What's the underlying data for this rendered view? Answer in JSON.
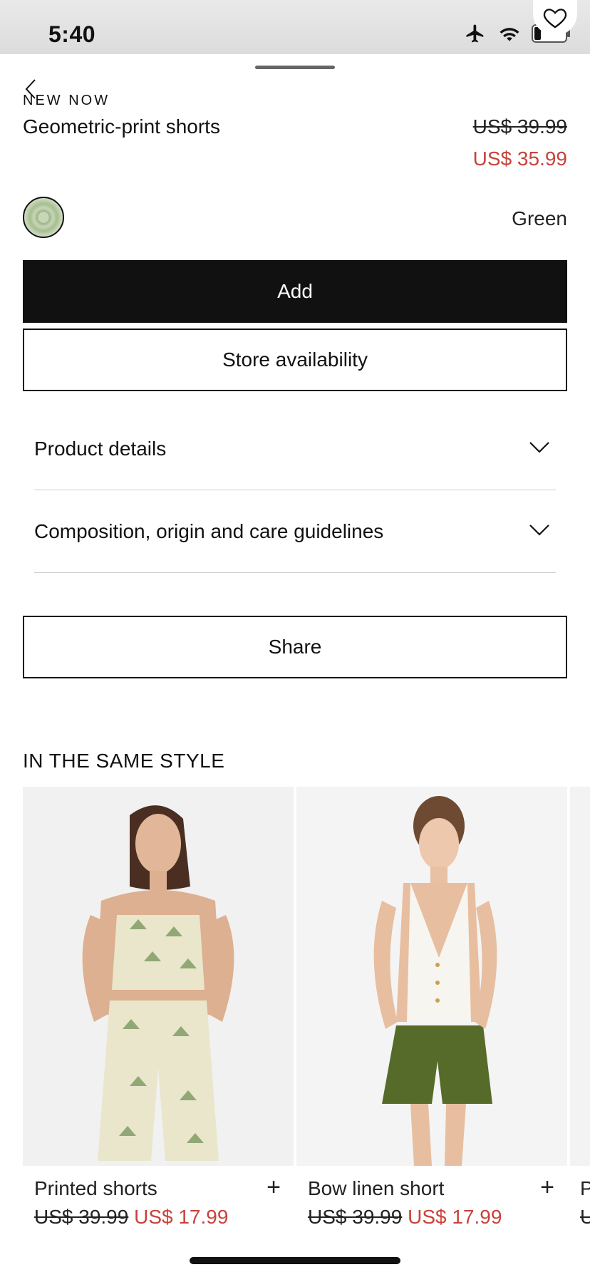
{
  "status_bar": {
    "time": "5:40"
  },
  "product": {
    "kicker": "NEW NOW",
    "title": "Geometric-print shorts",
    "old_price": "US$ 39.99",
    "new_price": "US$ 35.99",
    "color": "Green"
  },
  "actions": {
    "add": "Add",
    "store_availability": "Store availability",
    "share": "Share"
  },
  "accordions": [
    {
      "label": "Product details"
    },
    {
      "label": "Composition, origin and care guidelines"
    }
  ],
  "related": {
    "title": "IN THE SAME STYLE",
    "items": [
      {
        "name": "Printed shorts",
        "old_price": "US$ 39.99",
        "new_price": "US$ 17.99"
      },
      {
        "name": "Bow linen short",
        "old_price": "US$ 39.99",
        "new_price": "US$ 17.99"
      },
      {
        "name": "P",
        "old_price": "U",
        "new_price": ""
      }
    ]
  },
  "colors": {
    "accent_sale": "#c8423a",
    "primary_button": "#111111"
  },
  "icons": [
    "back-icon",
    "heart-icon",
    "airplane-icon",
    "wifi-icon",
    "battery-icon",
    "chevron-down-icon",
    "plus-icon"
  ]
}
